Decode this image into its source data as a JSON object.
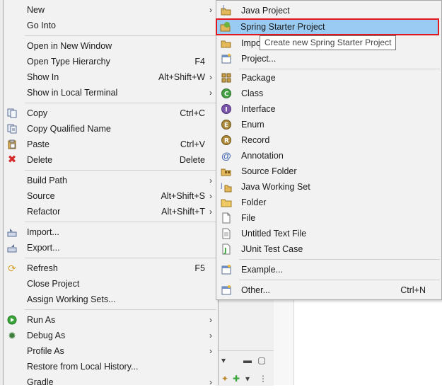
{
  "main_menu": {
    "items": [
      {
        "label": "New",
        "shortcut": "",
        "submenu": true,
        "icon": ""
      },
      {
        "label": "Go Into",
        "shortcut": "",
        "submenu": false,
        "icon": ""
      },
      {
        "label": "Open in New Window",
        "shortcut": "",
        "submenu": false,
        "icon": ""
      },
      {
        "label": "Open Type Hierarchy",
        "shortcut": "F4",
        "submenu": false,
        "icon": ""
      },
      {
        "label": "Show In",
        "shortcut": "Alt+Shift+W",
        "submenu": true,
        "icon": ""
      },
      {
        "label": "Show in Local Terminal",
        "shortcut": "",
        "submenu": true,
        "icon": ""
      },
      {
        "label": "Copy",
        "shortcut": "Ctrl+C",
        "submenu": false,
        "icon": "copy-icon"
      },
      {
        "label": "Copy Qualified Name",
        "shortcut": "",
        "submenu": false,
        "icon": "copy-qualified-icon"
      },
      {
        "label": "Paste",
        "shortcut": "Ctrl+V",
        "submenu": false,
        "icon": "paste-icon"
      },
      {
        "label": "Delete",
        "shortcut": "Delete",
        "submenu": false,
        "icon": "delete-icon"
      },
      {
        "label": "Build Path",
        "shortcut": "",
        "submenu": true,
        "icon": ""
      },
      {
        "label": "Source",
        "shortcut": "Alt+Shift+S",
        "submenu": true,
        "icon": ""
      },
      {
        "label": "Refactor",
        "shortcut": "Alt+Shift+T",
        "submenu": true,
        "icon": ""
      },
      {
        "label": "Import...",
        "shortcut": "",
        "submenu": false,
        "icon": "import-icon"
      },
      {
        "label": "Export...",
        "shortcut": "",
        "submenu": false,
        "icon": "export-icon"
      },
      {
        "label": "Refresh",
        "shortcut": "F5",
        "submenu": false,
        "icon": "refresh-icon"
      },
      {
        "label": "Close Project",
        "shortcut": "",
        "submenu": false,
        "icon": ""
      },
      {
        "label": "Assign Working Sets...",
        "shortcut": "",
        "submenu": false,
        "icon": ""
      },
      {
        "label": "Run As",
        "shortcut": "",
        "submenu": true,
        "icon": "run-icon"
      },
      {
        "label": "Debug As",
        "shortcut": "",
        "submenu": true,
        "icon": "debug-icon"
      },
      {
        "label": "Profile As",
        "shortcut": "",
        "submenu": true,
        "icon": ""
      },
      {
        "label": "Restore from Local History...",
        "shortcut": "",
        "submenu": false,
        "icon": ""
      },
      {
        "label": "Gradle",
        "shortcut": "",
        "submenu": true,
        "icon": ""
      }
    ]
  },
  "submenu": {
    "items": [
      {
        "label": "Java Project",
        "shortcut": "",
        "icon": "java-project-icon"
      },
      {
        "label": "Spring Starter Project",
        "shortcut": "",
        "icon": "spring-project-icon",
        "highlighted": true
      },
      {
        "label": "Impo",
        "shortcut": "",
        "icon": "import-project-icon"
      },
      {
        "label": "Project...",
        "shortcut": "",
        "icon": "project-icon"
      },
      {
        "label": "Package",
        "shortcut": "",
        "icon": "package-icon"
      },
      {
        "label": "Class",
        "shortcut": "",
        "icon": "class-icon"
      },
      {
        "label": "Interface",
        "shortcut": "",
        "icon": "interface-icon"
      },
      {
        "label": "Enum",
        "shortcut": "",
        "icon": "enum-icon"
      },
      {
        "label": "Record",
        "shortcut": "",
        "icon": "record-icon"
      },
      {
        "label": "Annotation",
        "shortcut": "",
        "icon": "annotation-icon"
      },
      {
        "label": "Source Folder",
        "shortcut": "",
        "icon": "source-folder-icon"
      },
      {
        "label": "Java Working Set",
        "shortcut": "",
        "icon": "working-set-icon"
      },
      {
        "label": "Folder",
        "shortcut": "",
        "icon": "folder-icon"
      },
      {
        "label": "File",
        "shortcut": "",
        "icon": "file-icon"
      },
      {
        "label": "Untitled Text File",
        "shortcut": "",
        "icon": "text-file-icon"
      },
      {
        "label": "JUnit Test Case",
        "shortcut": "",
        "icon": "junit-icon"
      },
      {
        "label": "Example...",
        "shortcut": "",
        "icon": "example-icon"
      },
      {
        "label": "Other...",
        "shortcut": "Ctrl+N",
        "icon": "other-icon"
      }
    ]
  },
  "tooltip": "Create new Spring Starter Project"
}
